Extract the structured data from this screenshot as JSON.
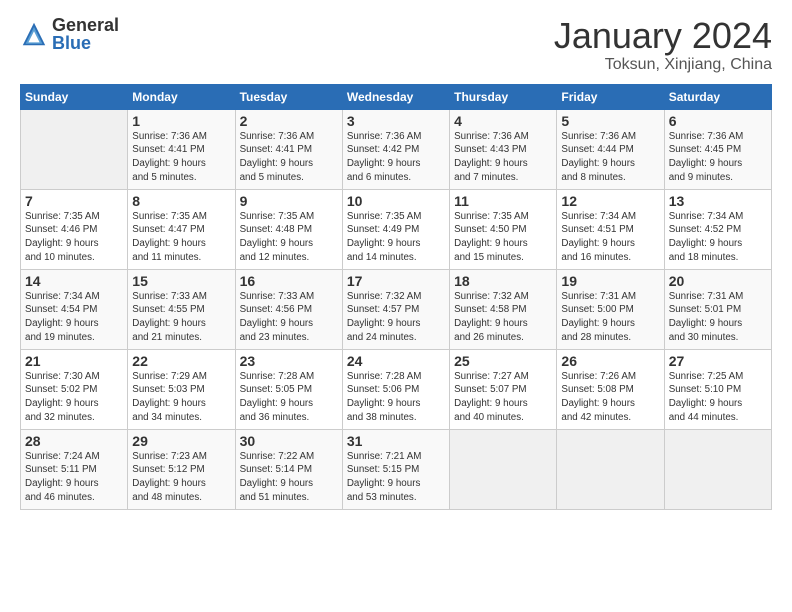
{
  "header": {
    "logo_general": "General",
    "logo_blue": "Blue",
    "title": "January 2024",
    "location": "Toksun, Xinjiang, China"
  },
  "days_of_week": [
    "Sunday",
    "Monday",
    "Tuesday",
    "Wednesday",
    "Thursday",
    "Friday",
    "Saturday"
  ],
  "weeks": [
    [
      {
        "num": "",
        "info": ""
      },
      {
        "num": "1",
        "info": "Sunrise: 7:36 AM\nSunset: 4:41 PM\nDaylight: 9 hours\nand 5 minutes."
      },
      {
        "num": "2",
        "info": "Sunrise: 7:36 AM\nSunset: 4:41 PM\nDaylight: 9 hours\nand 5 minutes."
      },
      {
        "num": "3",
        "info": "Sunrise: 7:36 AM\nSunset: 4:42 PM\nDaylight: 9 hours\nand 6 minutes."
      },
      {
        "num": "4",
        "info": "Sunrise: 7:36 AM\nSunset: 4:43 PM\nDaylight: 9 hours\nand 7 minutes."
      },
      {
        "num": "5",
        "info": "Sunrise: 7:36 AM\nSunset: 4:44 PM\nDaylight: 9 hours\nand 8 minutes."
      },
      {
        "num": "6",
        "info": "Sunrise: 7:36 AM\nSunset: 4:45 PM\nDaylight: 9 hours\nand 9 minutes."
      }
    ],
    [
      {
        "num": "7",
        "info": "Sunrise: 7:35 AM\nSunset: 4:46 PM\nDaylight: 9 hours\nand 10 minutes."
      },
      {
        "num": "8",
        "info": "Sunrise: 7:35 AM\nSunset: 4:47 PM\nDaylight: 9 hours\nand 11 minutes."
      },
      {
        "num": "9",
        "info": "Sunrise: 7:35 AM\nSunset: 4:48 PM\nDaylight: 9 hours\nand 12 minutes."
      },
      {
        "num": "10",
        "info": "Sunrise: 7:35 AM\nSunset: 4:49 PM\nDaylight: 9 hours\nand 14 minutes."
      },
      {
        "num": "11",
        "info": "Sunrise: 7:35 AM\nSunset: 4:50 PM\nDaylight: 9 hours\nand 15 minutes."
      },
      {
        "num": "12",
        "info": "Sunrise: 7:34 AM\nSunset: 4:51 PM\nDaylight: 9 hours\nand 16 minutes."
      },
      {
        "num": "13",
        "info": "Sunrise: 7:34 AM\nSunset: 4:52 PM\nDaylight: 9 hours\nand 18 minutes."
      }
    ],
    [
      {
        "num": "14",
        "info": "Sunrise: 7:34 AM\nSunset: 4:54 PM\nDaylight: 9 hours\nand 19 minutes."
      },
      {
        "num": "15",
        "info": "Sunrise: 7:33 AM\nSunset: 4:55 PM\nDaylight: 9 hours\nand 21 minutes."
      },
      {
        "num": "16",
        "info": "Sunrise: 7:33 AM\nSunset: 4:56 PM\nDaylight: 9 hours\nand 23 minutes."
      },
      {
        "num": "17",
        "info": "Sunrise: 7:32 AM\nSunset: 4:57 PM\nDaylight: 9 hours\nand 24 minutes."
      },
      {
        "num": "18",
        "info": "Sunrise: 7:32 AM\nSunset: 4:58 PM\nDaylight: 9 hours\nand 26 minutes."
      },
      {
        "num": "19",
        "info": "Sunrise: 7:31 AM\nSunset: 5:00 PM\nDaylight: 9 hours\nand 28 minutes."
      },
      {
        "num": "20",
        "info": "Sunrise: 7:31 AM\nSunset: 5:01 PM\nDaylight: 9 hours\nand 30 minutes."
      }
    ],
    [
      {
        "num": "21",
        "info": "Sunrise: 7:30 AM\nSunset: 5:02 PM\nDaylight: 9 hours\nand 32 minutes."
      },
      {
        "num": "22",
        "info": "Sunrise: 7:29 AM\nSunset: 5:03 PM\nDaylight: 9 hours\nand 34 minutes."
      },
      {
        "num": "23",
        "info": "Sunrise: 7:28 AM\nSunset: 5:05 PM\nDaylight: 9 hours\nand 36 minutes."
      },
      {
        "num": "24",
        "info": "Sunrise: 7:28 AM\nSunset: 5:06 PM\nDaylight: 9 hours\nand 38 minutes."
      },
      {
        "num": "25",
        "info": "Sunrise: 7:27 AM\nSunset: 5:07 PM\nDaylight: 9 hours\nand 40 minutes."
      },
      {
        "num": "26",
        "info": "Sunrise: 7:26 AM\nSunset: 5:08 PM\nDaylight: 9 hours\nand 42 minutes."
      },
      {
        "num": "27",
        "info": "Sunrise: 7:25 AM\nSunset: 5:10 PM\nDaylight: 9 hours\nand 44 minutes."
      }
    ],
    [
      {
        "num": "28",
        "info": "Sunrise: 7:24 AM\nSunset: 5:11 PM\nDaylight: 9 hours\nand 46 minutes."
      },
      {
        "num": "29",
        "info": "Sunrise: 7:23 AM\nSunset: 5:12 PM\nDaylight: 9 hours\nand 48 minutes."
      },
      {
        "num": "30",
        "info": "Sunrise: 7:22 AM\nSunset: 5:14 PM\nDaylight: 9 hours\nand 51 minutes."
      },
      {
        "num": "31",
        "info": "Sunrise: 7:21 AM\nSunset: 5:15 PM\nDaylight: 9 hours\nand 53 minutes."
      },
      {
        "num": "",
        "info": ""
      },
      {
        "num": "",
        "info": ""
      },
      {
        "num": "",
        "info": ""
      }
    ]
  ]
}
